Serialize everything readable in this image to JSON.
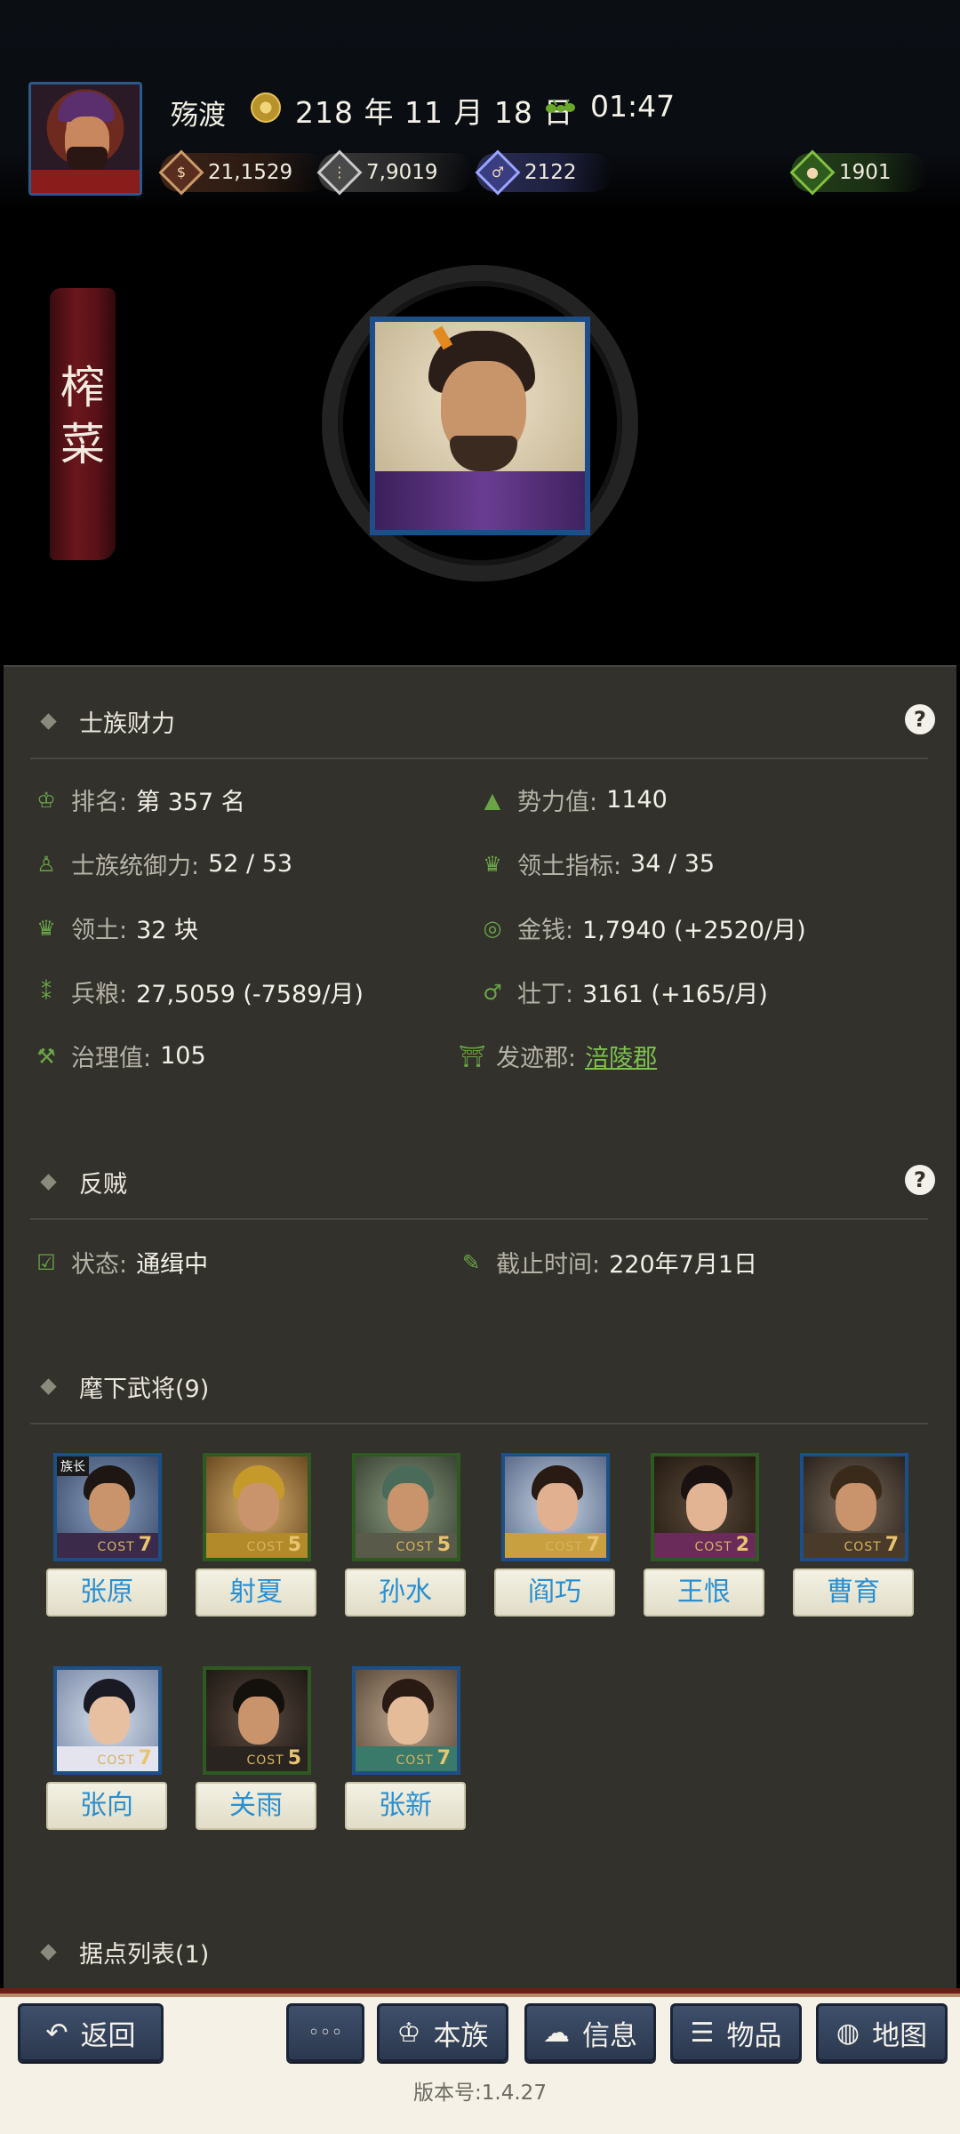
{
  "header": {
    "place": "殇渡",
    "date": "218 年 11 月 18 日",
    "time": "01:47",
    "resources": {
      "money": "21,1529",
      "grain": "7,9019",
      "manpower": "2122",
      "bag": "1901"
    },
    "icons": [
      "coin-icon",
      "grain-icon",
      "strongman-icon",
      "bag-icon",
      "date-seal-icon",
      "ant-icon"
    ]
  },
  "hero": {
    "banner_name": "榨菜"
  },
  "clan_wealth": {
    "title": "士族财力",
    "help": "?",
    "stats": {
      "rank_label": "排名:",
      "rank_value": "第 357 名",
      "power_label": "势力值:",
      "power_value": "1140",
      "control_label": "士族统御力:",
      "control_value": "52 / 53",
      "territory_index_label": "领土指标:",
      "territory_index_value": "34 / 35",
      "territory_label": "领土:",
      "territory_value": "32 块",
      "money_label": "金钱:",
      "money_value": "1,7940 (+2520/月)",
      "grain_label": "兵粮:",
      "grain_value": "27,5059 (-7589/月)",
      "men_label": "壮丁:",
      "men_value": "3161 (+165/月)",
      "govern_label": "治理值:",
      "govern_value": "105",
      "origin_label": "发迹郡:",
      "origin_value": "涪陵郡"
    }
  },
  "rebel": {
    "title": "反贼",
    "help": "?",
    "status_label": "状态:",
    "status_value": "通缉中",
    "deadline_label": "截止时间:",
    "deadline_value": "220年7月1日"
  },
  "officers": {
    "title": "麾下武将(9)",
    "cost_text": "COST",
    "leader_tag": "族长",
    "list": [
      {
        "name": "张原",
        "cost": "7"
      },
      {
        "name": "射夏",
        "cost": "5"
      },
      {
        "name": "孙水",
        "cost": "5"
      },
      {
        "name": "阎巧",
        "cost": "7"
      },
      {
        "name": "王恨",
        "cost": "2"
      },
      {
        "name": "曹育",
        "cost": "7"
      },
      {
        "name": "张向",
        "cost": "7"
      },
      {
        "name": "关雨",
        "cost": "5"
      },
      {
        "name": "张新",
        "cost": "7"
      }
    ]
  },
  "strongholds": {
    "title": "据点列表(1)"
  },
  "nav": {
    "back": "返回",
    "more": "◦◦◦",
    "clan": "本族",
    "info": "信息",
    "items": "物品",
    "map": "地图"
  },
  "version": "版本号:1.4.27",
  "colors": {
    "panel_bg": "#32312c",
    "accent_green": "#6aa447",
    "link_green": "#7dc24b",
    "name_blue": "#2a8fd0",
    "nav_button": "#2b384f"
  }
}
